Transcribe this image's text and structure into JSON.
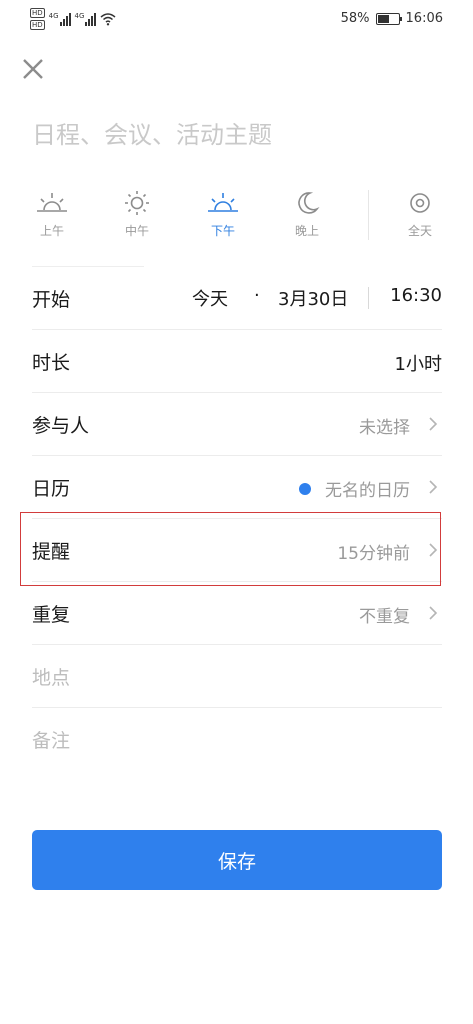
{
  "status_bar": {
    "hd1": "HD",
    "hd2": "HD",
    "net1": "4G",
    "net2": "4G",
    "battery_percent": "58%",
    "battery_level": 0.58,
    "time": "16:06"
  },
  "header": {
    "close_icon": "close-icon"
  },
  "event": {
    "title_placeholder": "日程、会议、活动主题",
    "title_value": ""
  },
  "periods": [
    {
      "label": "上午",
      "icon": "sunrise-icon",
      "active": false
    },
    {
      "label": "中午",
      "icon": "sun-icon",
      "active": false
    },
    {
      "label": "下午",
      "icon": "sunset-icon",
      "active": true
    },
    {
      "label": "晚上",
      "icon": "moon-icon",
      "active": false
    },
    {
      "label": "全天",
      "icon": "all-day-icon",
      "active": false
    }
  ],
  "form": {
    "start": {
      "label": "开始",
      "day": "今天",
      "separator": "·",
      "date": "3月30日",
      "time": "16:30"
    },
    "duration": {
      "label": "时长",
      "value": "1小时"
    },
    "participants": {
      "label": "参与人",
      "value": "未选择"
    },
    "calendar": {
      "label": "日历",
      "value": "无名的日历",
      "dot_color": "#2f80ed"
    },
    "reminder": {
      "label": "提醒",
      "value": "15分钟前"
    },
    "repeat": {
      "label": "重复",
      "value": "不重复"
    },
    "location": {
      "label": "地点"
    },
    "notes": {
      "label": "备注"
    }
  },
  "actions": {
    "save_label": "保存"
  },
  "colors": {
    "accent": "#2f80ed",
    "highlight": "#d23c3c"
  }
}
